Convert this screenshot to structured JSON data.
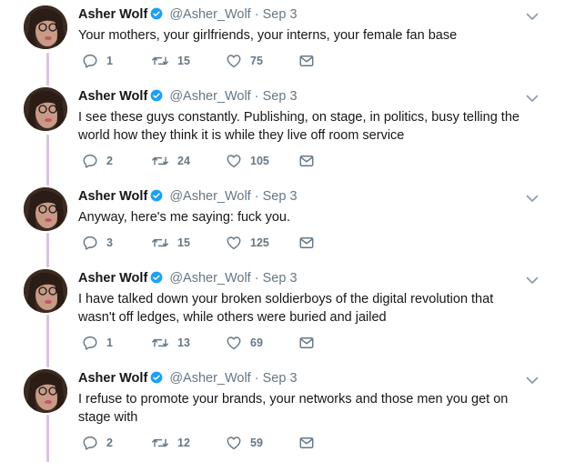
{
  "tweets": [
    {
      "author": "Asher Wolf",
      "handle": "@Asher_Wolf",
      "separator": "·",
      "date": "Sep 3",
      "text": "Your mothers, your girlfriends, your interns, your female fan base",
      "replies": "1",
      "retweets": "15",
      "likes": "75"
    },
    {
      "author": "Asher Wolf",
      "handle": "@Asher_Wolf",
      "separator": "·",
      "date": "Sep 3",
      "text": "I see these guys constantly. Publishing, on stage, in politics, busy telling the world how they think it is while they live off room service",
      "replies": "2",
      "retweets": "24",
      "likes": "105"
    },
    {
      "author": "Asher Wolf",
      "handle": "@Asher_Wolf",
      "separator": "·",
      "date": "Sep 3",
      "text": "Anyway, here's me saying: fuck you.",
      "replies": "3",
      "retweets": "15",
      "likes": "125"
    },
    {
      "author": "Asher Wolf",
      "handle": "@Asher_Wolf",
      "separator": "·",
      "date": "Sep 3",
      "text": "I have talked down your broken soldierboys of the digital revolution that wasn't off ledges, while others were buried and jailed",
      "replies": "1",
      "retweets": "13",
      "likes": "69"
    },
    {
      "author": "Asher Wolf",
      "handle": "@Asher_Wolf",
      "separator": "·",
      "date": "Sep 3",
      "text": "I refuse to promote your brands, your networks and those men you get on stage with",
      "replies": "2",
      "retweets": "12",
      "likes": "59"
    }
  ],
  "icons": {
    "reply": "reply-icon",
    "retweet": "retweet-icon",
    "like": "heart-icon",
    "dm": "envelope-icon",
    "verified": "verified-badge-icon",
    "caret": "chevron-down-icon"
  },
  "colors": {
    "text": "#14171a",
    "secondary": "#657786",
    "verified": "#1da1f2",
    "thread_line": "#d8c4e0"
  }
}
